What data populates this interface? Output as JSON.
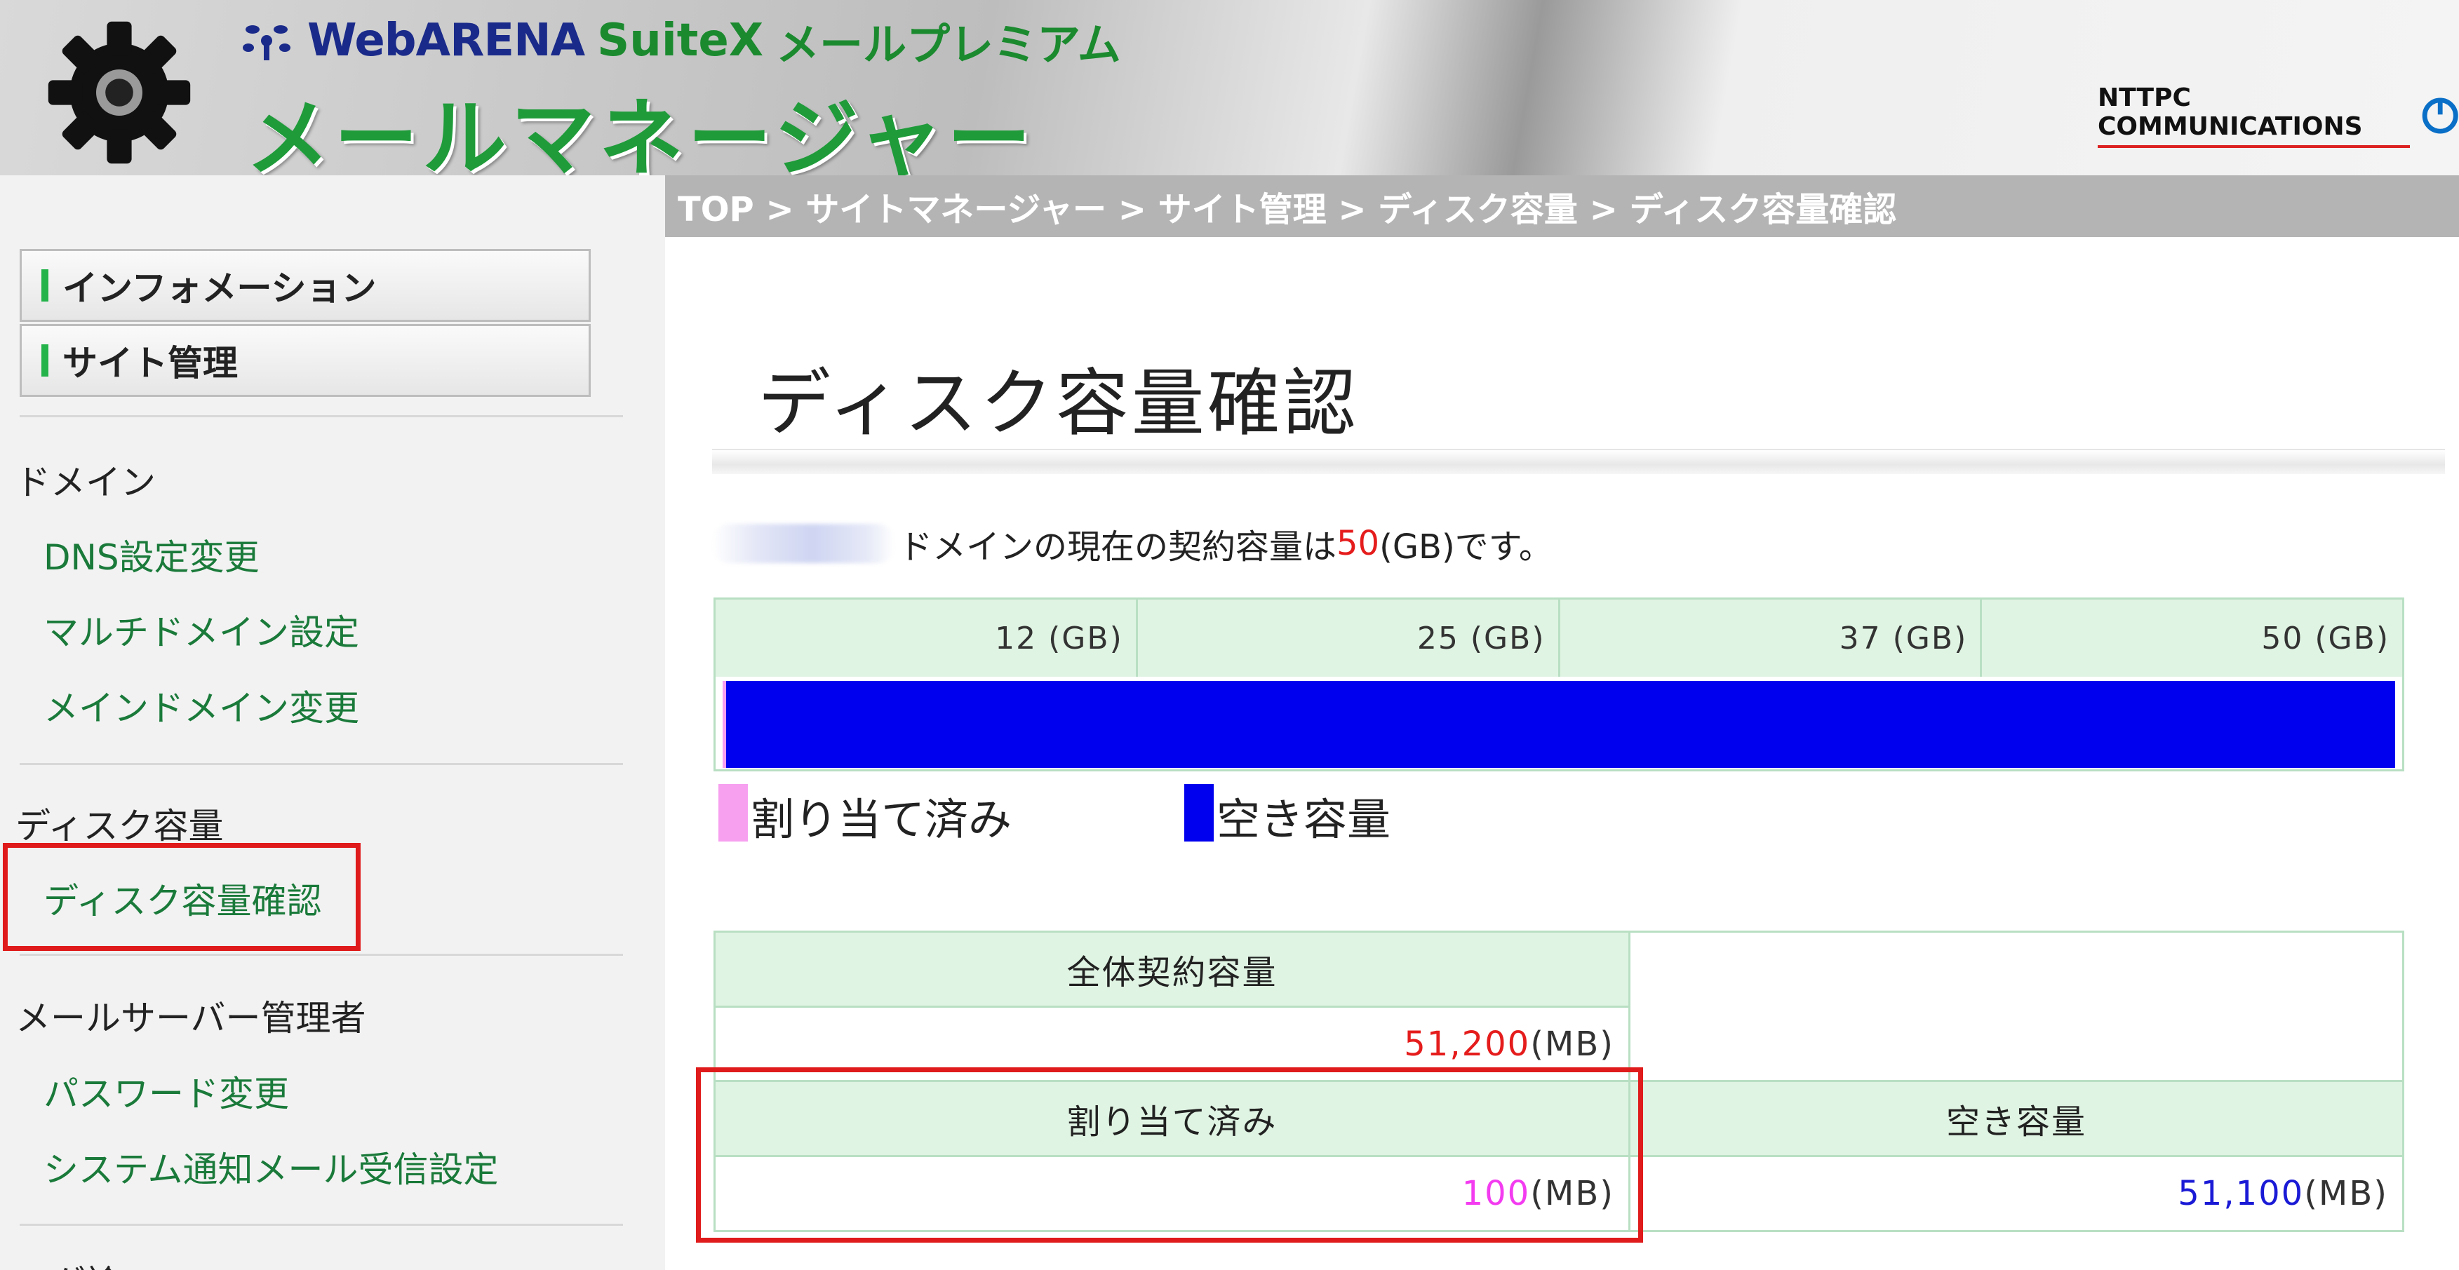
{
  "header": {
    "brand_web": "WebARENA",
    "brand_suite": "SuiteX",
    "brand_premium": "メールプレミアム",
    "app_title": "メールマネージャー",
    "corp_logo_text": "NTTPC COMMUNICATIONS",
    "gear_icon": "gear-icon"
  },
  "breadcrumb": "TOP > サイトマネージャー > サイト管理 > ディスク容量 > ディスク容量確認",
  "sidebar": {
    "buttons": [
      "インフォメーション",
      "サイト管理"
    ],
    "sections": [
      {
        "heading": "ドメイン",
        "links": [
          "DNS設定変更",
          "マルチドメイン設定",
          "メインドメイン変更"
        ]
      },
      {
        "heading": "ディスク容量",
        "links": [
          "ディスク容量確認"
        ]
      },
      {
        "heading": "メールサーバー管理者",
        "links": [
          "パスワード変更",
          "システム通知メール受信設定"
        ]
      }
    ],
    "next_heading_partial": "ログ論"
  },
  "main": {
    "title": "ディスク容量確認",
    "contract": {
      "prefix": "ドメインの現在の契約容量は ",
      "value": "50",
      "suffix": " (GB)です。"
    },
    "gauge": {
      "scale_labels": [
        "12 (GB)",
        "25 (GB)",
        "37 (GB)",
        "50 (GB)"
      ],
      "used_fraction": 0.002,
      "used_color": "#f7a0f0",
      "free_color": "#0000ee"
    },
    "legend": {
      "used_label": "割り当て済み",
      "free_label": "空き容量"
    },
    "table": {
      "total_label": "全体契約容量",
      "total_value": "51,200",
      "allocated_label": "割り当て済み",
      "allocated_value": "100",
      "free_label": "空き容量",
      "free_value": "51,100",
      "unit": " (MB)"
    }
  },
  "colors": {
    "accent_green": "#1f9b3a",
    "highlight_red": "#e01b1b",
    "table_header_bg": "#e0f4e3"
  }
}
